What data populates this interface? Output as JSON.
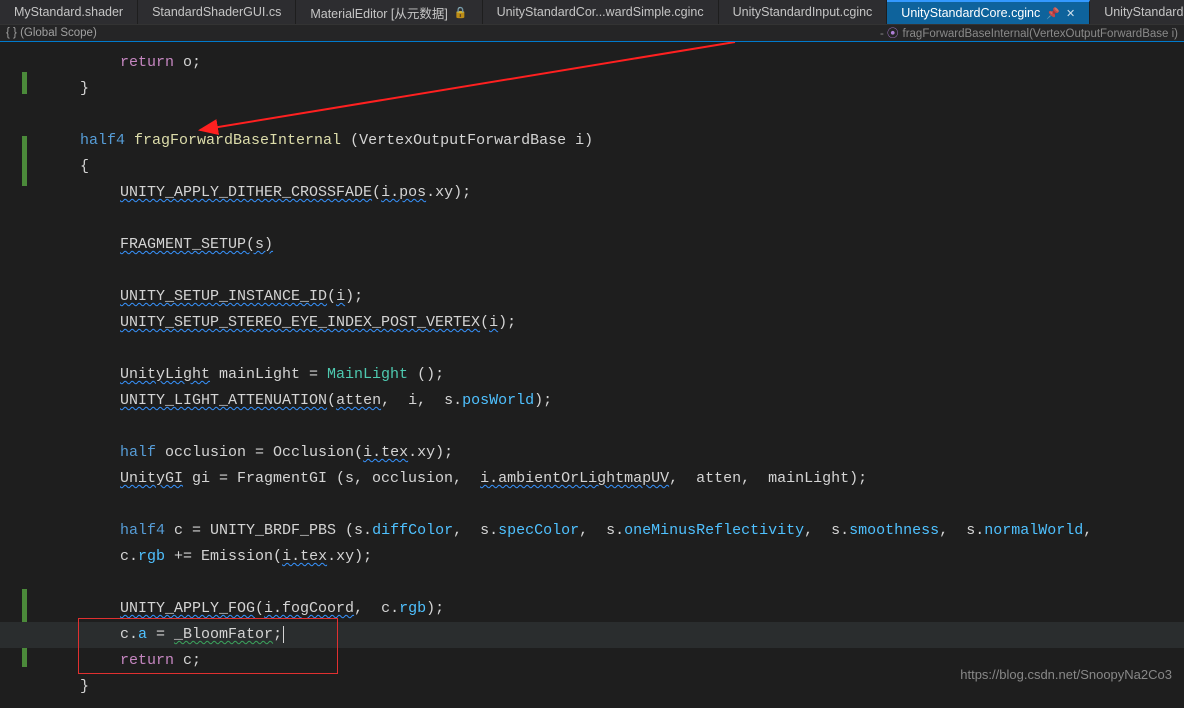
{
  "tabs": [
    {
      "label": "MyStandard.shader"
    },
    {
      "label": "StandardShaderGUI.cs"
    },
    {
      "label": "MaterialEditor [从元数据]",
      "locked": true
    },
    {
      "label": "UnityStandardCor...wardSimple.cginc"
    },
    {
      "label": "UnityStandardInput.cginc"
    },
    {
      "label": "UnityStandardCore.cginc",
      "active": true
    },
    {
      "label": "UnityStandardUtils.cginc"
    }
  ],
  "breadcrumb": {
    "scope": "{ } (Global Scope)",
    "function": "fragForwardBaseInternal(VertexOutputForwardBase i)"
  },
  "code": {
    "l1_kw": "return",
    "l1_rest": " o;",
    "l2": "}",
    "l3_type": "half4",
    "l3_fn": " fragForwardBaseInternal ",
    "l3_params": "(VertexOutputForwardBase i)",
    "l4": "{",
    "l5_fn": "UNITY_APPLY_DITHER_CROSSFADE",
    "l5_args": "(i.pos.xy);",
    "l6_fn": "FRAGMENT_SETUP",
    "l6_args": "(s)",
    "l7_fn": "UNITY_SETUP_INSTANCE_ID",
    "l7_args": "(i);",
    "l8_fn": "UNITY_SETUP_STEREO_EYE_INDEX_POST_VERTEX",
    "l8_args": "(i);",
    "l9_a": "UnityLight",
    "l9_b": " mainLight = ",
    "l9_c": "MainLight",
    "l9_d": " ();",
    "l10_fn": "UNITY_LIGHT_ATTENUATION",
    "l10_args": "(atten,  i,  s.posWorld);",
    "l11_a": "half",
    "l11_b": " occlusion = ",
    "l11_c": "Occlusion",
    "l11_d": "(i.tex.xy);",
    "l12_a": "UnityGI",
    "l12_b": " gi = FragmentGI (s, occlusion,  ",
    "l12_c": "i.ambientOrLightmapUV",
    "l12_d": ",  atten,  mainLight);",
    "l13_a": "half4",
    "l13_b": " c = UNITY_BRDF_PBS (s.diffColor,  s.specColor,  s.oneMinusReflectivity,  s.smoothness,  s.normalWorld,",
    "l14": "c.rgb += Emission(i.tex.xy);",
    "l15_fn": "UNITY_APPLY_FOG",
    "l15_args": "(i.fogCoord,  c.rgb);",
    "l16": "c.a = _BloomFator;",
    "l17_kw": "return",
    "l17_rest": " c;",
    "l18": "}"
  },
  "watermark": "https://blog.csdn.net/SnoopyNa2Co3"
}
